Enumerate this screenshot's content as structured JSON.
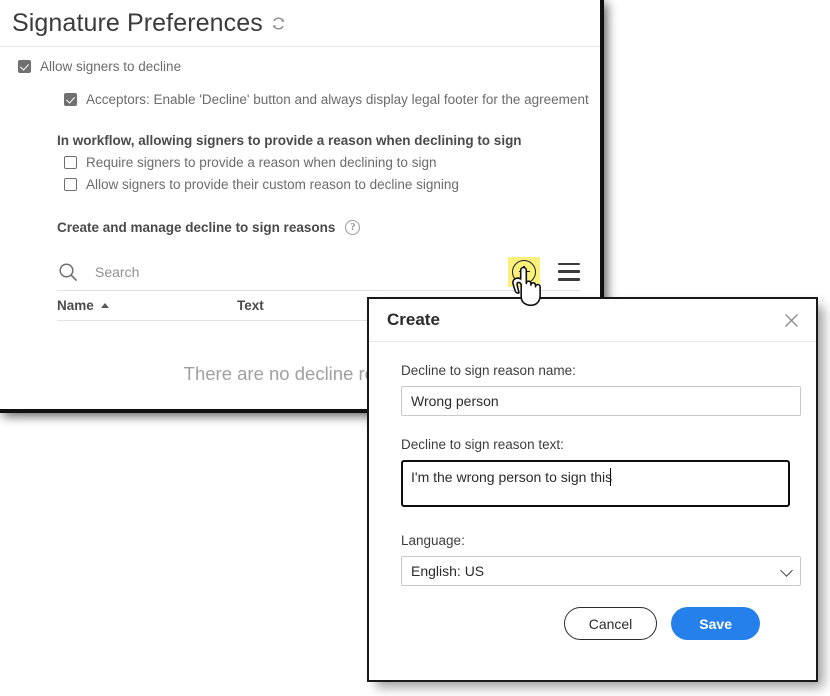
{
  "page": {
    "title": "Signature Preferences",
    "refresh_icon": "refresh-icon"
  },
  "preferences": {
    "allow_decline": {
      "label": "Allow signers to decline",
      "checked": true
    },
    "acceptors": {
      "label": "Acceptors: Enable 'Decline' button and always display legal footer for the agreement",
      "checked": true
    },
    "workflow_heading": "In workflow, allowing signers to provide a reason when declining to sign",
    "workflow_options": [
      {
        "label": "Require signers to provide a reason when declining to sign",
        "checked": false
      },
      {
        "label": "Allow signers to provide their custom reason to decline signing",
        "checked": false
      }
    ],
    "manage_heading": "Create and manage decline to sign reasons",
    "help_icon": "question-mark-circle-icon"
  },
  "toolbar": {
    "search_placeholder": "Search",
    "search_value": "",
    "search_icon": "search-icon",
    "add_icon": "plus-circle-icon",
    "add_highlight_color": "#fbf07a",
    "menu_icon": "hamburger-menu-icon"
  },
  "table": {
    "columns": [
      "Name",
      "Text"
    ],
    "sort_column": "Name",
    "sort_direction": "ascending",
    "sort_icon": "caret-up-icon",
    "rows": [],
    "empty_message": "There are no decline reasons"
  },
  "cursor": {
    "icon": "pointing-hand-cursor"
  },
  "modal": {
    "title": "Create",
    "close_icon": "close-icon",
    "name_label": "Decline to sign reason name:",
    "name_value": "Wrong person",
    "text_label": "Decline to sign reason text:",
    "text_value": "I'm the wrong person to sign this",
    "language_label": "Language:",
    "language_value": "English: US",
    "language_options": [
      "English: US"
    ],
    "dropdown_icon": "chevron-down-icon",
    "cancel_label": "Cancel",
    "save_label": "Save",
    "save_color": "#2680EB"
  }
}
